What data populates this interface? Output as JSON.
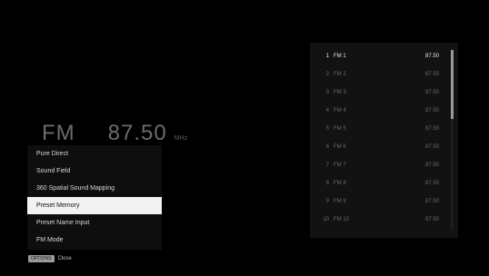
{
  "tuner": {
    "band": "FM",
    "frequency": "87.50",
    "unit": "MHz"
  },
  "options_menu": {
    "items": [
      {
        "label": "Pure Direct"
      },
      {
        "label": "Sound Field"
      },
      {
        "label": "360 Spatial Sound Mapping"
      },
      {
        "label": "Preset Memory"
      },
      {
        "label": "Preset Name Input"
      },
      {
        "label": "FM Mode"
      }
    ],
    "selected_index": 3
  },
  "hint": {
    "button": "OPTIONS",
    "action": "Close"
  },
  "presets": {
    "current_index": 0,
    "items": [
      {
        "num": "1",
        "name": "FM 1",
        "freq": "87.50"
      },
      {
        "num": "2",
        "name": "FM 2",
        "freq": "87.50"
      },
      {
        "num": "3",
        "name": "FM 3",
        "freq": "87.50"
      },
      {
        "num": "4",
        "name": "FM 4",
        "freq": "87.50"
      },
      {
        "num": "5",
        "name": "FM 5",
        "freq": "87.50"
      },
      {
        "num": "6",
        "name": "FM 6",
        "freq": "87.50"
      },
      {
        "num": "7",
        "name": "FM 7",
        "freq": "87.50"
      },
      {
        "num": "8",
        "name": "FM 8",
        "freq": "87.50"
      },
      {
        "num": "9",
        "name": "FM 9",
        "freq": "87.50"
      },
      {
        "num": "10",
        "name": "FM 10",
        "freq": "87.50"
      }
    ]
  },
  "colors": {
    "background": "#000000",
    "selected_item_bg": "#f2f2f2",
    "menu_bg": "#0e0e0e",
    "panel_bg": "#121212"
  }
}
